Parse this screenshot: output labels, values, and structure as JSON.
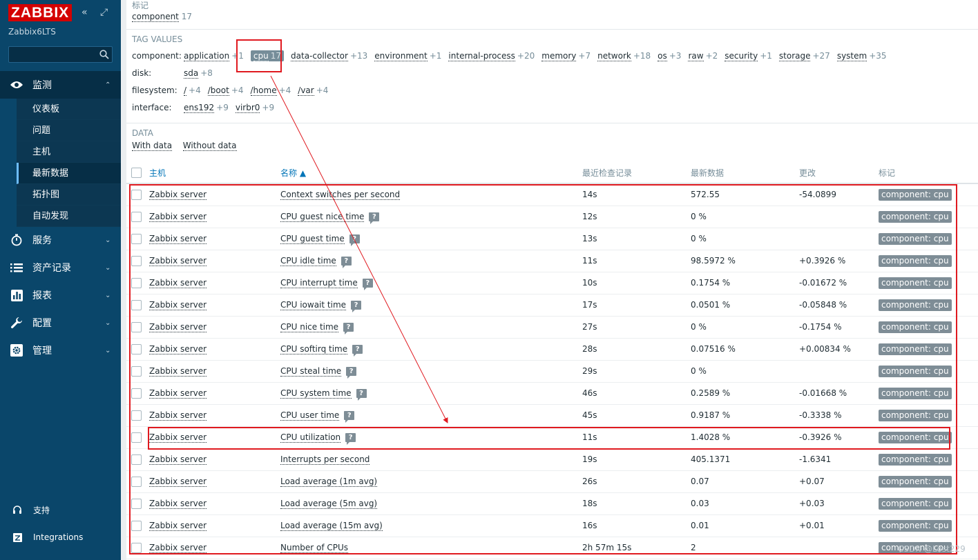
{
  "sidebar": {
    "logo": "ZABBIX",
    "collapse_glyph": "«",
    "expand_glyph": "⤢",
    "node_name": "Zabbix6LTS",
    "search_placeholder": "",
    "menu": [
      {
        "label": "监测",
        "chevron": "⌃",
        "active": true
      },
      {
        "label": "服务",
        "chevron": "⌄"
      },
      {
        "label": "资产记录",
        "chevron": "⌄"
      },
      {
        "label": "报表",
        "chevron": "⌄"
      },
      {
        "label": "配置",
        "chevron": "⌄"
      },
      {
        "label": "管理",
        "chevron": "⌄"
      }
    ],
    "submenu": [
      "仪表板",
      "问题",
      "主机",
      "最新数据",
      "拓扑图",
      "自动发现"
    ],
    "footer": [
      {
        "label": "支持"
      },
      {
        "label": "Integrations"
      }
    ]
  },
  "filter": {
    "tags_heading": "标记",
    "tags_item": {
      "name": "component",
      "count": "17"
    },
    "tag_values_heading": "TAG VALUES",
    "rows": [
      {
        "key": "component:",
        "values": [
          {
            "name": "application",
            "count": "+1"
          },
          {
            "name": "cpu",
            "count": "17",
            "selected": true
          },
          {
            "name": "data-collector",
            "count": "+13"
          },
          {
            "name": "environment",
            "count": "+1"
          },
          {
            "name": "internal-process",
            "count": "+20"
          },
          {
            "name": "memory",
            "count": "+7"
          },
          {
            "name": "network",
            "count": "+18"
          },
          {
            "name": "os",
            "count": "+3"
          },
          {
            "name": "raw",
            "count": "+2"
          },
          {
            "name": "security",
            "count": "+1"
          },
          {
            "name": "storage",
            "count": "+27"
          },
          {
            "name": "system",
            "count": "+35"
          }
        ]
      },
      {
        "key": "disk:",
        "values": [
          {
            "name": "sda",
            "count": "+8"
          }
        ]
      },
      {
        "key": "filesystem:",
        "values": [
          {
            "name": "/",
            "count": "+4"
          },
          {
            "name": "/boot",
            "count": "+4"
          },
          {
            "name": "/home",
            "count": "+4"
          },
          {
            "name": "/var",
            "count": "+4"
          }
        ]
      },
      {
        "key": "interface:",
        "values": [
          {
            "name": "ens192",
            "count": "+9"
          },
          {
            "name": "virbr0",
            "count": "+9"
          }
        ]
      }
    ],
    "data_heading": "DATA",
    "data_links": [
      "With data",
      "Without data"
    ]
  },
  "table": {
    "columns": [
      "主机",
      "名称 ▲",
      "最近检查记录",
      "最新数据",
      "更改",
      "标记"
    ],
    "rows": [
      {
        "host": "Zabbix server",
        "name": "Context switches per second",
        "help": false,
        "last": "14s",
        "value": "572.55",
        "change": "-54.0899",
        "tag": "component: cpu"
      },
      {
        "host": "Zabbix server",
        "name": "CPU guest nice time",
        "help": true,
        "last": "12s",
        "value": "0 %",
        "change": "",
        "tag": "component: cpu"
      },
      {
        "host": "Zabbix server",
        "name": "CPU guest time",
        "help": true,
        "last": "13s",
        "value": "0 %",
        "change": "",
        "tag": "component: cpu"
      },
      {
        "host": "Zabbix server",
        "name": "CPU idle time",
        "help": true,
        "last": "11s",
        "value": "98.5972 %",
        "change": "+0.3926 %",
        "tag": "component: cpu"
      },
      {
        "host": "Zabbix server",
        "name": "CPU interrupt time",
        "help": true,
        "last": "10s",
        "value": "0.1754 %",
        "change": "-0.01672 %",
        "tag": "component: cpu"
      },
      {
        "host": "Zabbix server",
        "name": "CPU iowait time",
        "help": true,
        "last": "17s",
        "value": "0.0501 %",
        "change": "-0.05848 %",
        "tag": "component: cpu"
      },
      {
        "host": "Zabbix server",
        "name": "CPU nice time",
        "help": true,
        "last": "27s",
        "value": "0 %",
        "change": "-0.1754 %",
        "tag": "component: cpu"
      },
      {
        "host": "Zabbix server",
        "name": "CPU softirq time",
        "help": true,
        "last": "28s",
        "value": "0.07516 %",
        "change": "+0.00834 %",
        "tag": "component: cpu"
      },
      {
        "host": "Zabbix server",
        "name": "CPU steal time",
        "help": true,
        "last": "29s",
        "value": "0 %",
        "change": "",
        "tag": "component: cpu"
      },
      {
        "host": "Zabbix server",
        "name": "CPU system time",
        "help": true,
        "last": "46s",
        "value": "0.2589 %",
        "change": "-0.01668 %",
        "tag": "component: cpu"
      },
      {
        "host": "Zabbix server",
        "name": "CPU user time",
        "help": true,
        "last": "45s",
        "value": "0.9187 %",
        "change": "-0.3338 %",
        "tag": "component: cpu"
      },
      {
        "host": "Zabbix server",
        "name": "CPU utilization",
        "help": true,
        "last": "11s",
        "value": "1.4028 %",
        "change": "-0.3926 %",
        "tag": "component: cpu"
      },
      {
        "host": "Zabbix server",
        "name": "Interrupts per second",
        "help": false,
        "last": "19s",
        "value": "405.1371",
        "change": "-1.6341",
        "tag": "component: cpu"
      },
      {
        "host": "Zabbix server",
        "name": "Load average (1m avg)",
        "help": false,
        "last": "26s",
        "value": "0.07",
        "change": "+0.07",
        "tag": "component: cpu"
      },
      {
        "host": "Zabbix server",
        "name": "Load average (5m avg)",
        "help": false,
        "last": "18s",
        "value": "0.03",
        "change": "+0.03",
        "tag": "component: cpu"
      },
      {
        "host": "Zabbix server",
        "name": "Load average (15m avg)",
        "help": false,
        "last": "16s",
        "value": "0.01",
        "change": "+0.01",
        "tag": "component: cpu"
      },
      {
        "host": "Zabbix server",
        "name": "Number of CPUs",
        "help": false,
        "last": "2h 57m 15s",
        "value": "2",
        "change": "",
        "tag": "component: cpu"
      }
    ],
    "help_glyph": "?"
  },
  "watermark": "CSDN @Lost229",
  "colors": {
    "sidebar": "#0a466a",
    "logo": "#d40000",
    "annotation": "#e0191f",
    "link": "#0275b8",
    "tag_pill": "#7e8d96"
  }
}
